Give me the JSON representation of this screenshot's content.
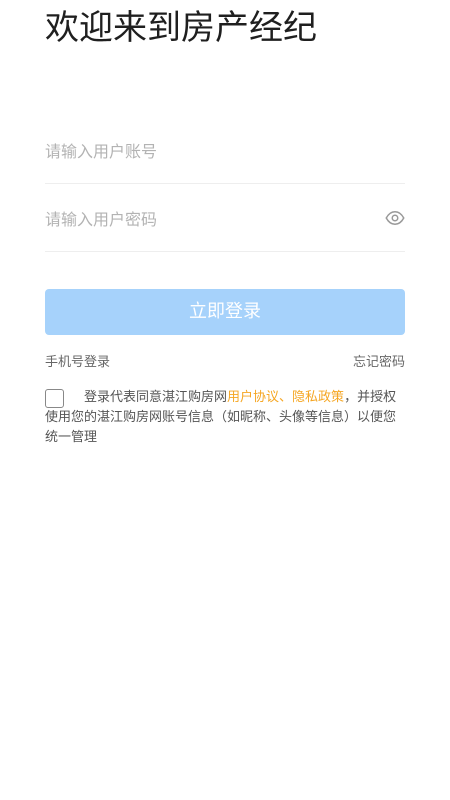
{
  "header": {
    "title": "欢迎来到房产经纪"
  },
  "form": {
    "account_placeholder": "请输入用户账号",
    "password_placeholder": "请输入用户密码",
    "eye_icon": "eye-icon",
    "login_label": "立即登录"
  },
  "links": {
    "phone_login": "手机号登录",
    "forgot_password": "忘记密码"
  },
  "agreement": {
    "prefix": "登录代表同意湛江购房网",
    "user_agreement": "用户协议",
    "separator": "、",
    "privacy_policy": "隐私政策",
    "suffix": "，并授权使用您的湛江购房网账号信息（如昵称、头像等信息）以便您统一管理"
  },
  "colors": {
    "button_bg": "#a6d2fb",
    "link_accent": "#f5a623"
  }
}
